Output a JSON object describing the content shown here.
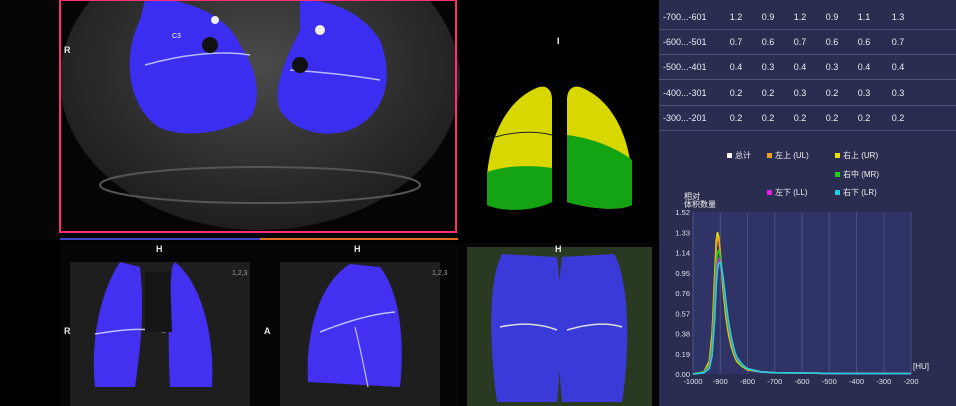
{
  "axial_view": {
    "orientation_label": "R",
    "cursor_label": "C3"
  },
  "coronal_view": {
    "top_label": "H",
    "side_label": "R",
    "scale_label": "1,2,3"
  },
  "sagittal_view": {
    "top_label": "H",
    "side_label": "A",
    "scale_label": "1,2,3"
  },
  "volume_view": {
    "top_label": "H"
  },
  "lobe_diagram": {
    "top_marker": "I",
    "colors": {
      "upper": "#d8d800",
      "lower": "#13a313"
    }
  },
  "distribution_table": {
    "rows": [
      {
        "range": "-700...-601",
        "values": [
          "1.2",
          "0.9",
          "1.2",
          "0.9",
          "1.1",
          "1.3"
        ]
      },
      {
        "range": "-600...-501",
        "values": [
          "0.7",
          "0.6",
          "0.7",
          "0.6",
          "0.6",
          "0.7"
        ]
      },
      {
        "range": "-500...-401",
        "values": [
          "0.4",
          "0.3",
          "0.4",
          "0.3",
          "0.4",
          "0.4"
        ]
      },
      {
        "range": "-400...-301",
        "values": [
          "0.2",
          "0.2",
          "0.3",
          "0.2",
          "0.3",
          "0.3"
        ]
      },
      {
        "range": "-300...-201",
        "values": [
          "0.2",
          "0.2",
          "0.2",
          "0.2",
          "0.2",
          "0.2"
        ]
      }
    ]
  },
  "legend": {
    "items": [
      {
        "label": "总计",
        "color": "#ffffff"
      },
      {
        "label": "左上 (UL)",
        "color": "#f0a020"
      },
      {
        "label": "右上 (UR)",
        "color": "#e8e000"
      },
      {
        "label": "右中 (MR)",
        "color": "#20d020"
      },
      {
        "label": "左下 (LL)",
        "color": "#e020e0"
      },
      {
        "label": "右下 (LR)",
        "color": "#20d0e0"
      }
    ]
  },
  "chart_data": {
    "type": "line",
    "ylabel": "相对\n体积数量",
    "xlabel": "[HU]",
    "xlim": [
      -1000,
      -200
    ],
    "ylim": [
      0,
      1.52
    ],
    "x_ticks": [
      -1000,
      -900,
      -800,
      -700,
      -600,
      -500,
      -400,
      -300,
      -200
    ],
    "y_ticks": [
      0,
      0.19,
      0.38,
      0.57,
      0.76,
      0.95,
      1.14,
      1.33,
      1.52
    ],
    "x": [
      -1000,
      -960,
      -940,
      -930,
      -920,
      -915,
      -910,
      -905,
      -900,
      -890,
      -880,
      -870,
      -860,
      -850,
      -840,
      -820,
      -800,
      -750,
      -700,
      -600,
      -500,
      -400,
      -300,
      -200
    ],
    "series": [
      {
        "name": "右上 (UR)",
        "color": "#e8e000",
        "values": [
          0,
          0.02,
          0.12,
          0.38,
          0.95,
          1.25,
          1.33,
          1.28,
          1.12,
          0.8,
          0.55,
          0.38,
          0.26,
          0.18,
          0.12,
          0.07,
          0.04,
          0.02,
          0.012,
          0.01,
          0.006,
          0.004,
          0.004,
          0.004
        ]
      },
      {
        "name": "左上 (UL)",
        "color": "#f0a020",
        "values": [
          0,
          0.02,
          0.1,
          0.32,
          0.86,
          1.18,
          1.28,
          1.26,
          1.14,
          0.86,
          0.6,
          0.42,
          0.29,
          0.2,
          0.14,
          0.08,
          0.05,
          0.02,
          0.012,
          0.01,
          0.006,
          0.004,
          0.004,
          0.004
        ]
      },
      {
        "name": "右中 (MR)",
        "color": "#20d020",
        "values": [
          0,
          0.02,
          0.08,
          0.26,
          0.74,
          1.04,
          1.14,
          1.16,
          1.1,
          0.88,
          0.64,
          0.45,
          0.31,
          0.21,
          0.14,
          0.08,
          0.05,
          0.02,
          0.012,
          0.01,
          0.006,
          0.004,
          0.004,
          0.004
        ]
      },
      {
        "name": "左下 (LL)",
        "color": "#e020e0",
        "values": [
          0,
          0.01,
          0.06,
          0.2,
          0.6,
          0.9,
          1.04,
          1.08,
          1.06,
          0.9,
          0.68,
          0.48,
          0.33,
          0.23,
          0.15,
          0.09,
          0.05,
          0.02,
          0.012,
          0.01,
          0.006,
          0.004,
          0.004,
          0.004
        ]
      },
      {
        "name": "右下 (LR)",
        "color": "#20d0e0",
        "values": [
          0,
          0.01,
          0.05,
          0.17,
          0.52,
          0.82,
          0.98,
          1.04,
          1.05,
          0.92,
          0.7,
          0.5,
          0.35,
          0.24,
          0.16,
          0.09,
          0.05,
          0.02,
          0.012,
          0.01,
          0.006,
          0.004,
          0.004,
          0.004
        ]
      }
    ]
  }
}
